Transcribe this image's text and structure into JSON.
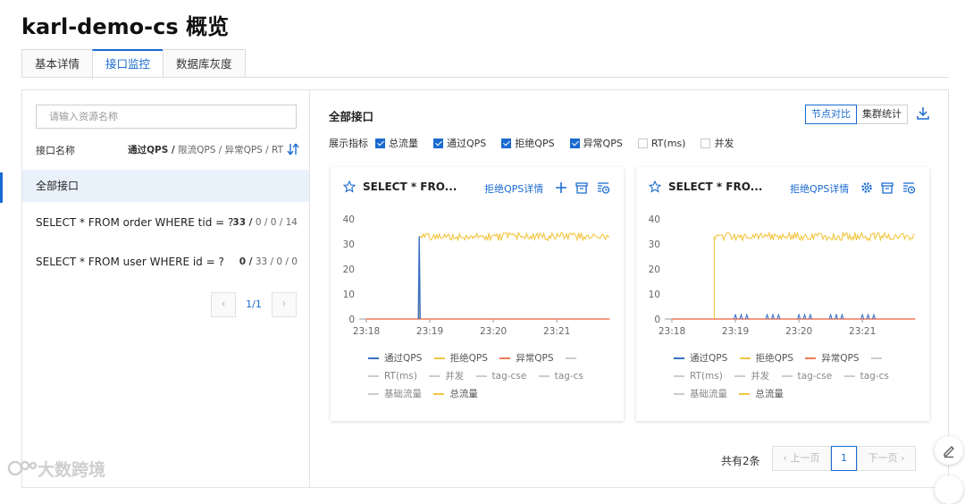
{
  "page": {
    "title": "karl-demo-cs 概览"
  },
  "tabs": [
    {
      "label": "基本详情"
    },
    {
      "label": "接口监控"
    },
    {
      "label": "数据库灰度"
    }
  ],
  "sidebar": {
    "search_placeholder": "请输入资源名称",
    "column_name": "接口名称",
    "column_metrics_bold": "通过QPS /",
    "column_metrics_rest": " 限流QPS / 异常QPS / RT",
    "rows": [
      {
        "name": "全部接口",
        "stats_bold": "",
        "stats_rest": ""
      },
      {
        "name": "SELECT * FROM order WHERE tid = ?",
        "stats_bold": "33 /",
        "stats_rest": " 0 / 0 / 14"
      },
      {
        "name": "SELECT * FROM user WHERE id = ?",
        "stats_bold": "0 /",
        "stats_rest": " 33 / 0 / 0"
      }
    ],
    "pagination": {
      "prev": "‹",
      "text": "1/1",
      "next": "›"
    }
  },
  "main": {
    "title": "全部接口",
    "buttons": {
      "node_compare": "节点对比",
      "cluster_stats": "集群统计"
    },
    "metrics_label": "展示指标",
    "metrics": [
      {
        "label": "总流量",
        "checked": true
      },
      {
        "label": "通过QPS",
        "checked": true
      },
      {
        "label": "拒绝QPS",
        "checked": true
      },
      {
        "label": "异常QPS",
        "checked": true
      },
      {
        "label": "RT(ms)",
        "checked": false
      },
      {
        "label": "并发",
        "checked": false
      }
    ],
    "cards": [
      {
        "title": "SELECT * FRO...",
        "link": "拒绝QPS详情",
        "icon3": "plus-icon"
      },
      {
        "title": "SELECT * FRO...",
        "link": "拒绝QPS详情",
        "icon3": "gear-icon"
      }
    ],
    "legend_row1": [
      "通过QPS",
      "拒绝QPS",
      "异常QPS"
    ],
    "legend_row2": [
      "RT(ms)",
      "并发",
      "tag-cse",
      "tag-cs"
    ],
    "legend_row3": [
      "基础流量",
      "总流量"
    ],
    "colors": {
      "pass": "#3a6fc4",
      "reject": "#f2c641",
      "exception": "#f07a5c",
      "muted": "#cccccc",
      "accent": "#1a6bd0"
    },
    "pager": {
      "total": "共有2条",
      "prev": "上一页",
      "page": "1",
      "next": "下一页"
    }
  },
  "chart_data": [
    {
      "type": "line",
      "x_ticks": [
        "23:18",
        "23:19",
        "23:20",
        "23:21"
      ],
      "ylim": [
        0,
        40
      ],
      "y_ticks": [
        0,
        10,
        20,
        30,
        40
      ],
      "series": [
        {
          "name": "通过QPS",
          "description": "spike to ~33 just before 23:19 then drops to 0",
          "spike_x": "23:18:50",
          "value": 33
        },
        {
          "name": "拒绝QPS",
          "level": 33,
          "start_x": "23:18:50",
          "end_x": "23:21:50"
        },
        {
          "name": "异常QPS",
          "level": 0
        }
      ]
    },
    {
      "type": "line",
      "x_ticks": [
        "23:18",
        "23:19",
        "23:20",
        "23:21"
      ],
      "ylim": [
        0,
        40
      ],
      "y_ticks": [
        0,
        10,
        20,
        30,
        40
      ],
      "series": [
        {
          "name": "拒绝QPS",
          "level": 33,
          "start_x": "23:18:40",
          "end_x": "23:21:50"
        },
        {
          "name": "异常QPS",
          "level": 0
        },
        {
          "name": "通过QPS",
          "level": 0
        }
      ]
    }
  ],
  "watermark": "大数跨境"
}
